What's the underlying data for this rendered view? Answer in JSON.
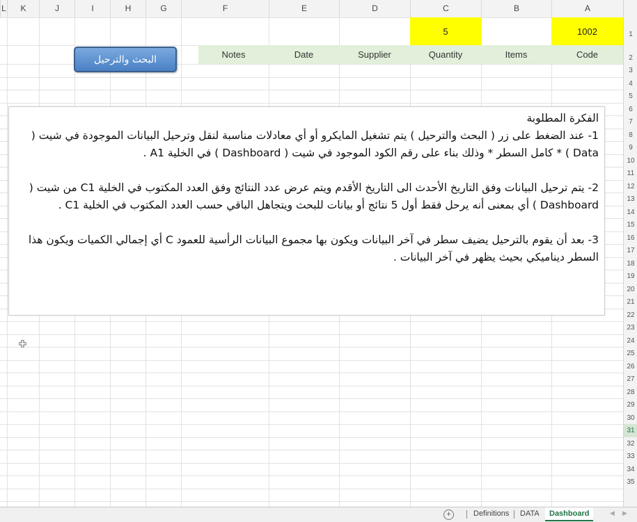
{
  "columns": [
    "L",
    "K",
    "J",
    "I",
    "H",
    "G",
    "F",
    "E",
    "D",
    "C",
    "B",
    "A"
  ],
  "rows": [
    "1",
    "2",
    "3",
    "4",
    "5",
    "6",
    "7",
    "8",
    "9",
    "10",
    "11",
    "12",
    "13",
    "14",
    "15",
    "16",
    "17",
    "18",
    "19",
    "20",
    "21",
    "22",
    "23",
    "24",
    "25",
    "26",
    "27",
    "28",
    "29",
    "30",
    "31",
    "32",
    "33",
    "34",
    "35"
  ],
  "active_row": "31",
  "cells": {
    "a1": "1002",
    "c1": "5",
    "headers": [
      "Code",
      "Items",
      "Quantity",
      "Supplier",
      "Date",
      "Notes"
    ]
  },
  "button": {
    "label": "البحث والترحيل"
  },
  "textbox": {
    "title": "الفكرة المطلوبة",
    "p1": "1- عند الضغط على زر ( البحث والترحيل ) يتم تشغيل المايكرو أو أي معادلات مناسبة لنقل وترحيل البيانات الموجودة في شيت ( Data ) * كامل السطر * وذلك بناء على رقم الكود الموجود في شيت ( Dashboard ) في الخلية A1 .",
    "p2": "2- يتم ترحيل البيانات وفق التاريخ الأحدث الى التاريخ الأقدم ويتم عرض عدد النتائج وفق العدد المكتوب في الخلية C1 من شيت ( Dashboard ) أي بمعنى أنه يرحل فقط أول 5 نتائج أو بيانات للبحث ويتجاهل الباقي حسب العدد المكتوب في الخلية C1 .",
    "p3": "3- بعد أن يقوم بالترحيل يضيف سطر في آخر البيانات ويكون بها مجموع البيانات الرأسية للعمود C أي إجمالي الكميات ويكون هذا السطر ديناميكي بحيث يظهر في آخر البيانات ."
  },
  "sheet_tabs": [
    "Definitions",
    "DATA",
    "Dashboard"
  ],
  "active_tab": "Dashboard",
  "colors": {
    "yellow": "#ffff00",
    "header_green": "#e2efda",
    "excel_green": "#217346",
    "button_blue": "#4a81c4"
  }
}
